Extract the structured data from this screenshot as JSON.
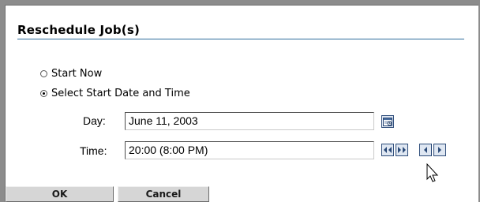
{
  "dialog": {
    "title": "Reschedule Job(s)"
  },
  "options": {
    "start_now": {
      "label": "Start Now",
      "selected": false
    },
    "select_start": {
      "label": "Select Start Date and Time",
      "selected": true
    }
  },
  "day": {
    "label": "Day:",
    "value": "June 11, 2003",
    "icon": "calendar-icon"
  },
  "time": {
    "label": "Time:",
    "value": "20:00 (8:00 PM)",
    "controls": [
      "double-left-arrow-icon",
      "double-right-arrow-icon",
      "left-arrow-icon",
      "right-arrow-icon"
    ]
  },
  "buttons": {
    "ok": "OK",
    "cancel": "Cancel"
  },
  "colors": {
    "accent": "#2d6c9c",
    "button_face": "#d6d6d6",
    "backdrop": "#8c8c8c"
  }
}
